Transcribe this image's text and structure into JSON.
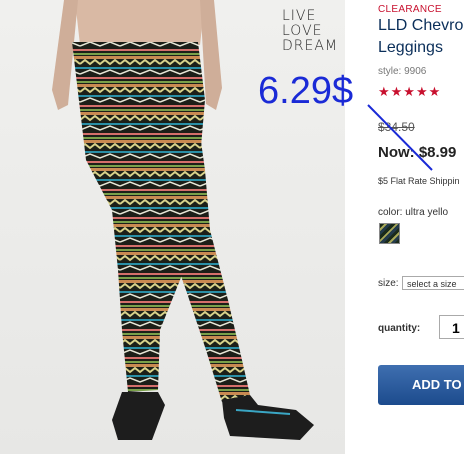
{
  "brand": {
    "line1": "LIVE",
    "line2": "LOVE",
    "line3": "DREAM"
  },
  "product": {
    "badge": "CLEARANCE",
    "title_line1": "LLD Chevro",
    "title_line2": "Leggings",
    "style": "style: 9906",
    "stars": "★★★★★",
    "was_price": "$34.50",
    "now_price": "Now: $8.99",
    "shipping": "$5 Flat Rate Shippin",
    "color_label": "color: ultra yello",
    "size_label": "size:",
    "size_select": "select a size",
    "quantity_label": "quantity:",
    "quantity_value": "1",
    "add_button": "ADD TO"
  },
  "annotation": {
    "price_text": "6.29$",
    "color": "#1a2ad6"
  }
}
